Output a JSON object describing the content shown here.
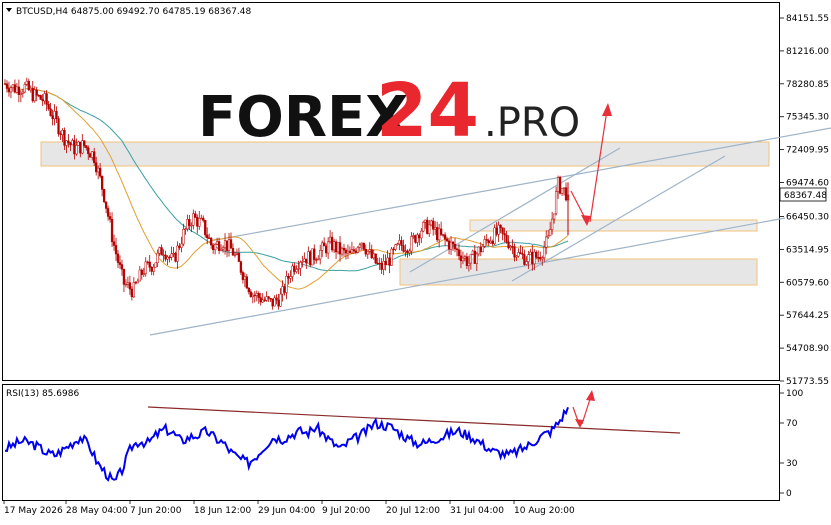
{
  "header": {
    "symbol_line": "BTCUSD,H4  64875.00 69492.70 64785.19 68367.48",
    "rsi_label": "RSI(13) 85.6986"
  },
  "watermark": {
    "brand_main": "FOREX",
    "brand_number": "24",
    "brand_suffix": ".PRO"
  },
  "colors": {
    "candle": "#b30000",
    "ma_fast": "#e0a030",
    "ma_slow": "#3aa0a0",
    "trendline": "#9fb4c8",
    "zone_fill": "#e6e6e6",
    "zone_border": "#f2c27a",
    "arrow": "#e8303a",
    "rsi_line": "#0000ee",
    "rsi_trend": "#8a2b2b",
    "current_price_tag": "#ffffff"
  },
  "chart_data": [
    {
      "type": "candlestick",
      "ylim": [
        50000,
        86500
      ],
      "ytick_labels": [
        "84151.55",
        "81216.00",
        "78280.85",
        "75345.30",
        "72409.95",
        "69474.60",
        "66450.30",
        "63514.95",
        "60579.60",
        "57644.25",
        "54708.90",
        "51773.55"
      ],
      "xtick_labels": [
        "17 May 2026",
        "28 May 04:00",
        "7 Jun 20:00",
        "18 Jun 12:00",
        "29 Jun 04:00",
        "9 Jul 20:00",
        "20 Jul 12:00",
        "31 Jul 04:00",
        "10 Aug 20:00"
      ],
      "current_price": "68367.48",
      "close_series_approx": [
        78300,
        77900,
        78000,
        77200,
        76800,
        75200,
        73500,
        72500,
        72800,
        71900,
        68500,
        64000,
        60500,
        59800,
        61700,
        62200,
        63600,
        62400,
        64800,
        66400,
        65700,
        63700,
        64300,
        63400,
        61600,
        59600,
        59100,
        58700,
        59300,
        61800,
        62800,
        62800,
        63400,
        64000,
        63300,
        62900,
        64500,
        62900,
        61800,
        62700,
        63900,
        63900,
        65300,
        65600,
        64700,
        64000,
        63200,
        62300,
        63400,
        64500,
        65000,
        64200,
        63000,
        62700,
        62900,
        64300,
        69300,
        68367
      ],
      "resistance_zone": [
        71400,
        73500
      ],
      "middle_zone": [
        65500,
        66300
      ],
      "support_zone": [
        60300,
        62600
      ]
    },
    {
      "type": "line",
      "title": "RSI(13) 85.6986",
      "ylim": [
        0,
        100
      ],
      "ytick_labels": [
        "100",
        "70",
        "30",
        "0"
      ],
      "last_value": 85.6986,
      "series_approx": [
        44,
        48,
        52,
        50,
        46,
        40,
        38,
        44,
        50,
        56,
        48,
        30,
        20,
        10,
        24,
        46,
        52,
        50,
        58,
        64,
        60,
        52,
        56,
        58,
        62,
        55,
        50,
        40,
        34,
        30,
        38,
        48,
        56,
        54,
        58,
        62,
        60,
        66,
        58,
        50,
        44,
        52,
        56,
        62,
        70,
        68,
        66,
        60,
        54,
        50,
        50,
        54,
        56,
        60,
        62,
        58,
        54,
        48,
        42,
        40,
        38,
        42,
        46,
        52,
        58,
        62,
        72,
        85.7
      ]
    }
  ]
}
